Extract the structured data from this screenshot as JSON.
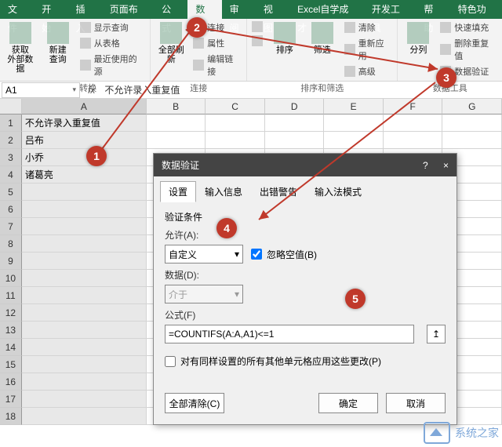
{
  "menu": {
    "tabs": [
      "文件",
      "开始",
      "插入",
      "页面布局",
      "公式",
      "数据",
      "审阅",
      "视图",
      "Excel自学成才",
      "开发工具",
      "帮助",
      "特色功能"
    ],
    "active": 5
  },
  "ribbon": {
    "groups": [
      {
        "label": "获取和转换",
        "big": [
          {
            "label": "获取\n外部数据"
          },
          {
            "label": "新建\n查询"
          }
        ],
        "small": [
          "显示查询",
          "从表格",
          "最近使用的源"
        ]
      },
      {
        "label": "连接",
        "big": [
          {
            "label": "全部刷新"
          }
        ],
        "small": [
          "连接",
          "属性",
          "编辑链接"
        ]
      },
      {
        "label": "排序和筛选",
        "big": [
          {
            "label": "排序"
          },
          {
            "label": "筛选"
          }
        ],
        "small": [
          "清除",
          "重新应用",
          "高级"
        ],
        "prefix_icons": [
          "A↓Z",
          "Z↓A"
        ]
      },
      {
        "label": "数据工具",
        "big": [
          {
            "label": "分列"
          }
        ],
        "small": [
          "快速填充",
          "删除重复值",
          "数据验证"
        ]
      }
    ]
  },
  "namebox": "A1",
  "formula": "不允许录入重复值",
  "columns": [
    "A",
    "B",
    "C",
    "D",
    "E",
    "F",
    "G"
  ],
  "cells": {
    "A1": "不允许录入重复值",
    "A2": "吕布",
    "A3": "小乔",
    "A4": "诸葛亮"
  },
  "rows": 18,
  "dialog": {
    "title": "数据验证",
    "tabs": [
      "设置",
      "输入信息",
      "出错警告",
      "输入法模式"
    ],
    "active_tab": 0,
    "section_label": "验证条件",
    "allow_label": "允许(A):",
    "allow_value": "自定义",
    "ignore_blank_label": "忽略空值(B)",
    "ignore_blank_checked": true,
    "data_label": "数据(D):",
    "data_value": "介于",
    "formula_label": "公式(F)",
    "formula_value": "=COUNTIFS(A:A,A1)<=1",
    "apply_label": "对有同样设置的所有其他单元格应用这些更改(P)",
    "apply_checked": false,
    "clear_label": "全部清除(C)",
    "ok_label": "确定",
    "cancel_label": "取消",
    "help_icon": "?",
    "close_icon": "×"
  },
  "callouts": {
    "1": "1",
    "2": "2",
    "3": "3",
    "4": "4",
    "5": "5"
  },
  "watermark": "系统之家"
}
